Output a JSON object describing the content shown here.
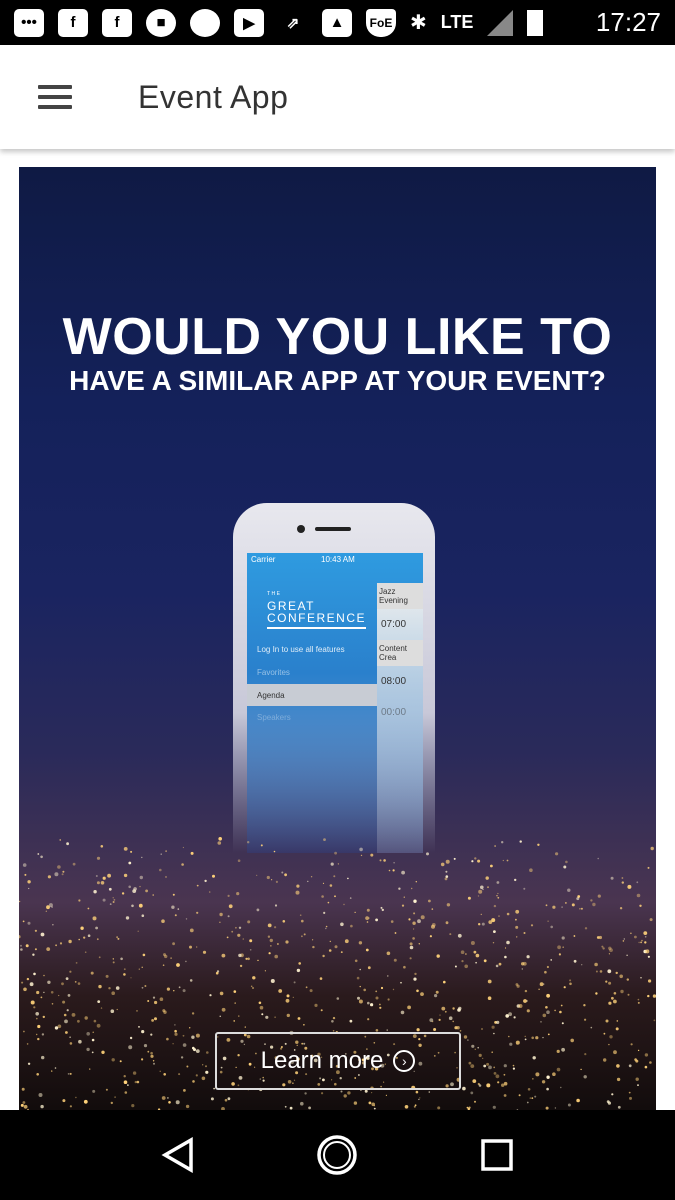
{
  "status_bar": {
    "icons": [
      "messages-icon",
      "facebook-icon",
      "facebook-icon",
      "uber-icon",
      "signal-icon",
      "youtube-icon",
      "jira-icon",
      "gallery-icon",
      "foe-icon",
      "bluetooth-icon",
      "lte-icon",
      "signal-strength-icon",
      "battery-charging-icon"
    ],
    "network": "LTE",
    "time": "17:27"
  },
  "app_bar": {
    "title": "Event App",
    "menu_icon": "hamburger-icon"
  },
  "banner": {
    "headline": "WOULD YOU LIKE TO",
    "subheadline": "HAVE A SIMILAR APP AT YOUR EVENT?",
    "phone": {
      "carrier": "Carrier",
      "clock": "10:43 AM",
      "brand_small": "THE",
      "brand_line1": "GREAT",
      "brand_line2": "CONFERENCE",
      "menu": [
        "Log In to use all features",
        "Favorites",
        "Agenda",
        "Speakers"
      ],
      "side_sections": [
        "Jazz Evening",
        "07:00",
        "Content Crea",
        "08:00",
        "00:00"
      ]
    },
    "cta_label": "Learn more",
    "colors": {
      "top": "#0f1a44",
      "bottom": "#120c0c",
      "accent": "#2f9be0"
    }
  },
  "nav_bar": {
    "buttons": [
      "back",
      "home",
      "recents"
    ]
  }
}
